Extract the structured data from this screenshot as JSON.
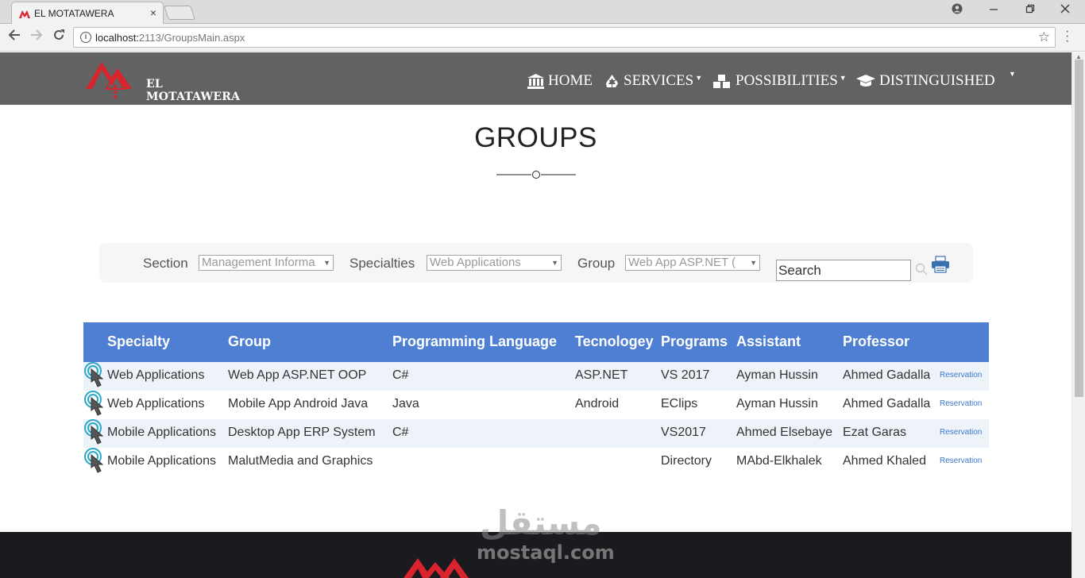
{
  "browser": {
    "tab_title": "EL MOTATAWERA",
    "tab_close": "×",
    "url_host": "localhost:",
    "url_path": "2113/GroupsMain.aspx"
  },
  "site": {
    "brand": "EL MOTATAWERA",
    "nav": [
      {
        "label": "HOME",
        "icon": "bank-icon"
      },
      {
        "label": "SERVICES",
        "icon": "recycle-icon",
        "dropdown": true
      },
      {
        "label": "POSSIBILITIES",
        "icon": "cubes-icon",
        "dropdown": true
      },
      {
        "label": "DISTINGUISHED",
        "icon": "graduation-cap-icon",
        "dropdown": true
      }
    ],
    "accent_red": "#d9232d",
    "nav_bg": "#626262"
  },
  "page": {
    "title": "GROUPS"
  },
  "filters": {
    "section_label": "Section",
    "section_value": "Management Informa",
    "specialties_label": "Specialties",
    "specialties_value": "Web Applications",
    "group_label": "Group",
    "group_value": "Web App ASP.NET (",
    "search_value": "Search"
  },
  "table": {
    "header_color": "#4f7fd3",
    "columns": [
      "Specialty",
      "Group",
      "Programming Language",
      "Tecnologey",
      "Programs",
      "Assistant",
      "Professor"
    ],
    "rows": [
      {
        "specialty": "Web Applications",
        "group": "Web App ASP.NET OOP",
        "language": "C#",
        "technology": "ASP.NET",
        "programs": "VS 2017",
        "assistant": "Ayman Hussin",
        "professor": "Ahmed Gadalla",
        "action": "Reservation"
      },
      {
        "specialty": "Web Applications",
        "group": "Mobile App Android Java",
        "language": "Java",
        "technology": "Android",
        "programs": "EClips",
        "assistant": "Ayman Hussin",
        "professor": "Ahmed Gadalla",
        "action": "Reservation"
      },
      {
        "specialty": "Mobile Applications",
        "group": "Desktop App ERP System",
        "language": "C#",
        "technology": "",
        "programs": "VS2017",
        "assistant": "Ahmed Elsebaye",
        "professor": "Ezat Garas",
        "action": "Reservation"
      },
      {
        "specialty": "Mobile Applications",
        "group": "MalutMedia and Graphics",
        "language": "",
        "technology": "",
        "programs": "Directory",
        "assistant": "MAbd-Elkhalek",
        "professor": "Ahmed Khaled",
        "action": "Reservation"
      }
    ]
  },
  "watermark": {
    "arabic": "مستقل",
    "latin": "mostaql.com"
  }
}
